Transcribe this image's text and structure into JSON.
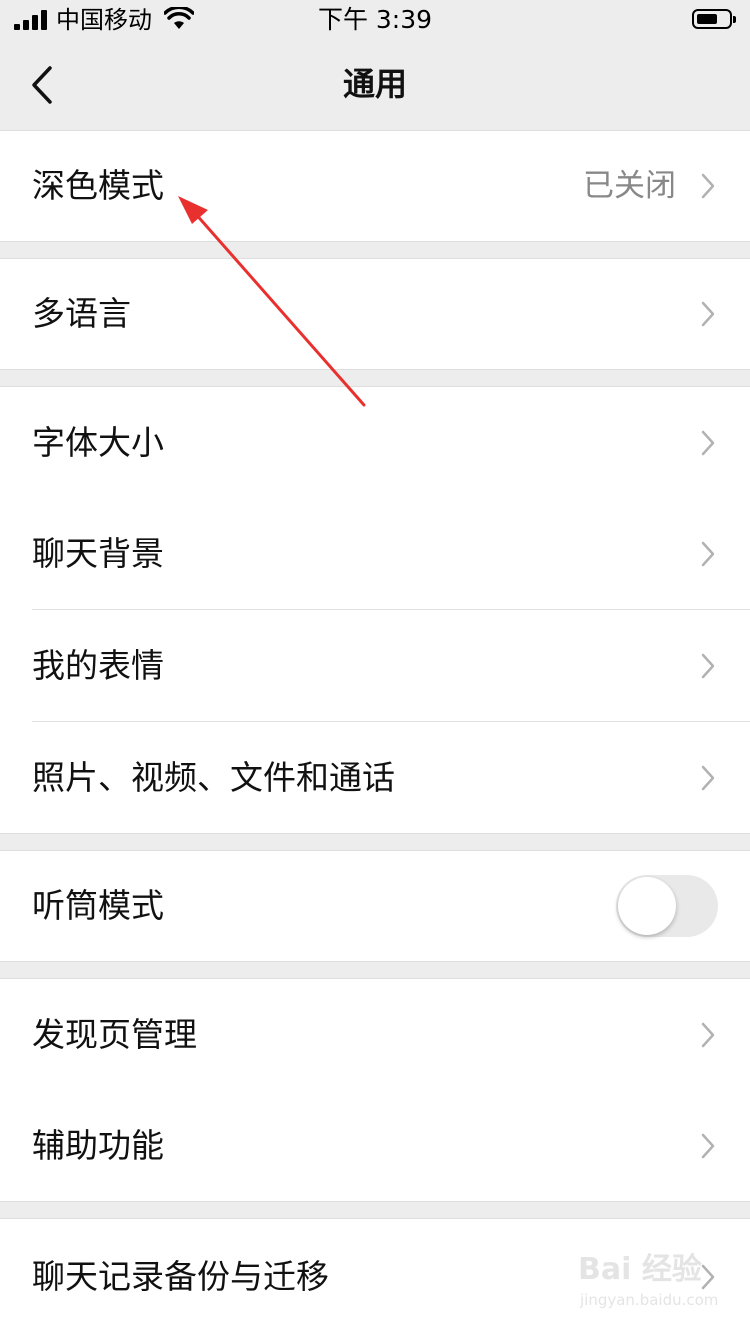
{
  "status_bar": {
    "carrier": "中国移动",
    "time": "下午 3:39"
  },
  "nav": {
    "title": "通用",
    "back_icon": "chevron-left-icon"
  },
  "rows": [
    {
      "id": "dark-mode",
      "label": "深色模式",
      "value": "已关闭"
    },
    {
      "id": "language",
      "label": "多语言"
    },
    {
      "id": "font-size",
      "label": "字体大小"
    },
    {
      "id": "chat-background",
      "label": "聊天背景"
    },
    {
      "id": "my-stickers",
      "label": "我的表情"
    },
    {
      "id": "media-files",
      "label": "照片、视频、文件和通话"
    },
    {
      "id": "earpiece-mode",
      "label": "听筒模式",
      "toggle": false
    },
    {
      "id": "discover-management",
      "label": "发现页管理"
    },
    {
      "id": "accessibility",
      "label": "辅助功能"
    },
    {
      "id": "chat-backup",
      "label": "聊天记录备份与迁移"
    }
  ],
  "watermark": {
    "brand": "Bai 经验",
    "sub": "jingyan.baidu.com"
  },
  "colors": {
    "background": "#ededed",
    "row": "#ffffff",
    "arrow": "#e8312f",
    "secondary_text": "#888888"
  }
}
